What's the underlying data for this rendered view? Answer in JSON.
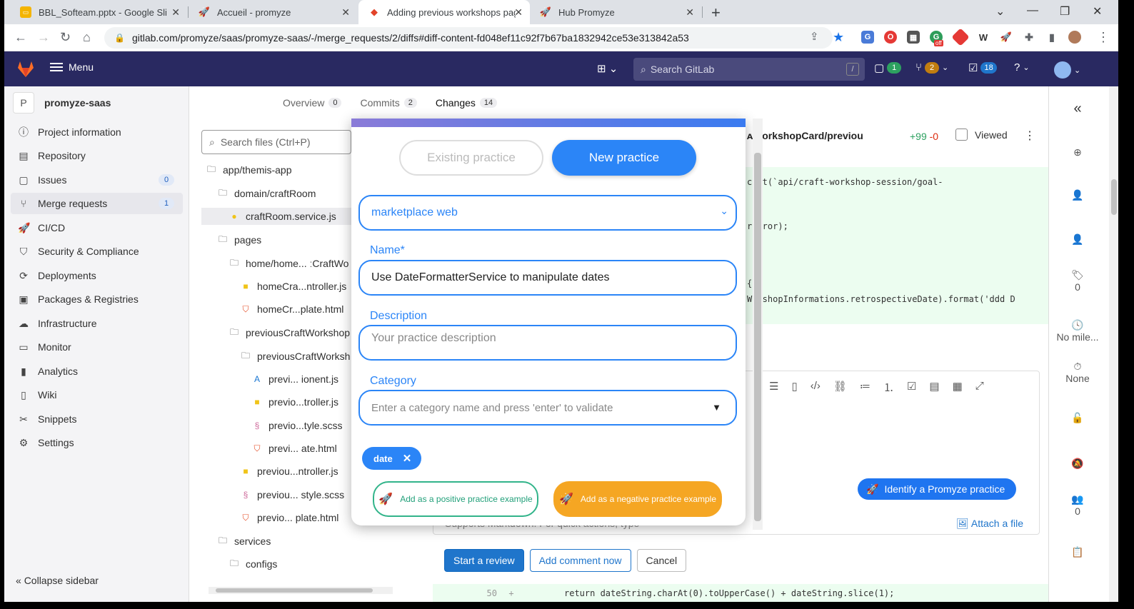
{
  "browser": {
    "tabs": [
      {
        "title": "BBL_Softeam.pptx - Google Slide",
        "active": false
      },
      {
        "title": "Accueil - promyze",
        "active": false
      },
      {
        "title": "Adding previous workshops pag",
        "active": true
      },
      {
        "title": "Hub Promyze",
        "active": false
      }
    ],
    "url": "gitlab.com/promyze/saas/promyze-saas/-/merge_requests/2/diffs#diff-content-fd048ef11c92f7b67ba1832942ce53e313842a53",
    "ext_badge": "off"
  },
  "header": {
    "menu_label": "Menu",
    "search_placeholder": "Search GitLab",
    "search_shortcut": "/",
    "issues_count": "1",
    "mr_count": "2",
    "todo_count": "18"
  },
  "sidebar": {
    "project_initial": "P",
    "project_name": "promyze-saas",
    "items": [
      {
        "label": "Project information",
        "icon": "info-icon"
      },
      {
        "label": "Repository",
        "icon": "book-icon"
      },
      {
        "label": "Issues",
        "icon": "issues-icon",
        "badge": "0"
      },
      {
        "label": "Merge requests",
        "icon": "merge-request-icon",
        "badge": "1"
      },
      {
        "label": "CI/CD",
        "icon": "rocket-icon"
      },
      {
        "label": "Security & Compliance",
        "icon": "shield-icon"
      },
      {
        "label": "Deployments",
        "icon": "deploy-icon"
      },
      {
        "label": "Packages & Registries",
        "icon": "package-icon"
      },
      {
        "label": "Infrastructure",
        "icon": "cloud-icon"
      },
      {
        "label": "Monitor",
        "icon": "monitor-icon"
      },
      {
        "label": "Analytics",
        "icon": "chart-icon"
      },
      {
        "label": "Wiki",
        "icon": "wiki-icon"
      },
      {
        "label": "Snippets",
        "icon": "scissors-icon"
      },
      {
        "label": "Settings",
        "icon": "gear-icon"
      }
    ],
    "collapse_label": "Collapse sidebar"
  },
  "mr_tabs": [
    {
      "label": "Overview",
      "count": "0"
    },
    {
      "label": "Commits",
      "count": "2"
    },
    {
      "label": "Changes",
      "count": "14"
    }
  ],
  "file_tree": {
    "search_placeholder": "Search files (Ctrl+P)",
    "rows": [
      {
        "label": "app/themis-app",
        "type": "folder"
      },
      {
        "label": "domain/craftRoom",
        "type": "folder"
      },
      {
        "label": "craftRoom.service.js",
        "type": "js"
      },
      {
        "label": "pages",
        "type": "folder"
      },
      {
        "label": "home/home... ːCraftWo",
        "type": "folder"
      },
      {
        "label": "homeCra...ntroller.js",
        "type": "js"
      },
      {
        "label": "homeCr...plate.html",
        "type": "html"
      },
      {
        "label": "previousCraftWorkshop",
        "type": "folder"
      },
      {
        "label": "previousCraftWorksh",
        "type": "folder"
      },
      {
        "label": "previ...  ionent.js",
        "type": "angular"
      },
      {
        "label": "previo...troller.js",
        "type": "js"
      },
      {
        "label": "previo...tyle.scss",
        "type": "scss"
      },
      {
        "label": "previ...  ate.html",
        "type": "html"
      },
      {
        "label": "previou...ntroller.js",
        "type": "js"
      },
      {
        "label": "previou...  style.scss",
        "type": "scss"
      },
      {
        "label": "previo...  plate.html",
        "type": "html"
      },
      {
        "label": "services",
        "type": "folder"
      },
      {
        "label": "configs",
        "type": "folder"
      }
    ]
  },
  "diff": {
    "file_name": "ᴀWorkshopCard/previou",
    "additions": "+99",
    "deletions": "-0",
    "viewed_label": "Viewed",
    "code_lines": [
      "c│et(`api/craft-workshop-session/goal-",
      "r  rror);",
      "{",
      "W│:shopInformations.retrospectiveDate).format('ddd D"
    ],
    "bottom_line_number": "50",
    "bottom_line_marker": "+",
    "bottom_line_code": "return dateString.charAt(0).toUpperCase() + dateString.slice(1);",
    "promyze_button": "Identify a Promyze practice",
    "attach_label": "Attach a file",
    "hint_text": "Supports Markdown. For quick actions, type",
    "start_review": "Start a review",
    "add_comment": "Add comment now",
    "cancel": "Cancel"
  },
  "right_sidebar": {
    "labels_count": "0",
    "milestone": "No mile...",
    "time_tracking": "None",
    "participants_count": "0"
  },
  "modal": {
    "existing_label": "Existing practice",
    "new_label": "New practice",
    "space_value": "marketplace web",
    "name_label": "Name*",
    "name_value": "Use DateFormatterService to manipulate dates",
    "description_label": "Description",
    "description_placeholder": "Your practice description",
    "category_label": "Category",
    "category_placeholder": "Enter a category name and press 'enter' to validate",
    "chip_label": "date",
    "positive_label": "Add as a positive practice example",
    "negative_label": "Add as a negative practice example"
  },
  "colors": {
    "gitlab_header": "#292961",
    "promyze_blue": "#2b85f7",
    "positive_green": "#32b48a",
    "negative_orange": "#f5a623"
  }
}
